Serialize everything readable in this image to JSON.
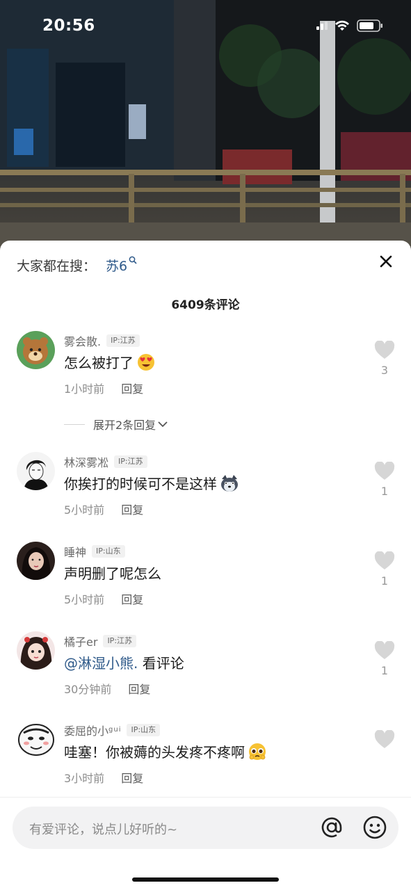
{
  "status_bar": {
    "time": "20:56"
  },
  "search": {
    "prefix": "大家都在搜：",
    "term": "苏6",
    "search_icon": "search-icon"
  },
  "sheet": {
    "comment_count_title": "6409条评论",
    "close_icon": "close-icon"
  },
  "comments": [
    {
      "name": "雾会散.",
      "ip": "IP:江苏",
      "text": "怎么被打了",
      "emoji": "heart-eyes-emoji",
      "time": "1小时前",
      "reply": "回复",
      "likes": "3"
    },
    {
      "name": "林深雾凇",
      "ip": "IP:江苏",
      "text": "你挨打的时候可不是这样",
      "emoji": "husky-emoji",
      "time": "5小时前",
      "reply": "回复",
      "likes": "1"
    },
    {
      "name": "睡神",
      "ip": "IP:山东",
      "text": "声明删了呢怎么",
      "time": "5小时前",
      "reply": "回复",
      "likes": "1"
    },
    {
      "name": "橘子er",
      "ip": "IP:江苏",
      "mention": "@淋湿小熊.",
      "text": " 看评论",
      "time": "30分钟前",
      "reply": "回复",
      "likes": "1"
    },
    {
      "name": "委屈的小",
      "name_sup": "gui",
      "ip": "IP:山东",
      "text": "哇塞！你被薅的头发疼不疼啊",
      "emoji": "pleading-emoji",
      "time": "3小时前",
      "reply": "回复",
      "likes": ""
    }
  ],
  "expand_replies": {
    "label": "展开2条回复"
  },
  "input": {
    "placeholder": "有爱评论，说点儿好听的~",
    "at_icon": "at-icon",
    "emoji_icon": "emoji-face-icon"
  },
  "colors": {
    "link_blue": "#2f5a8a",
    "sheet_bg": "#ffffff",
    "meta_gray": "#8d8d8d"
  }
}
